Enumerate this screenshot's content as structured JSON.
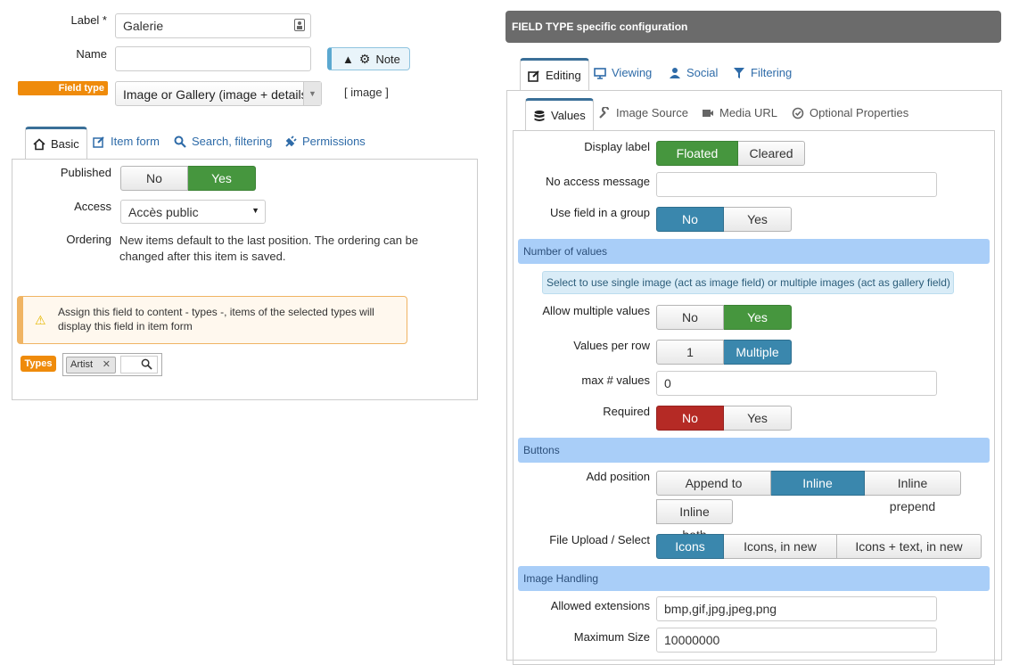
{
  "left": {
    "label_label": "Label *",
    "label_value": "Galerie",
    "name_label": "Name",
    "name_value": "",
    "note_label": "Note",
    "field_type_badge": "Field type",
    "field_type_value": "Image or Gallery (image + details)",
    "field_type_code": "[ image ]",
    "tabs": [
      {
        "label": "Basic",
        "icon": "home-icon"
      },
      {
        "label": "Item form",
        "icon": "edit-icon"
      },
      {
        "label": "Search, filtering",
        "icon": "search-icon"
      },
      {
        "label": "Permissions",
        "icon": "plug-icon"
      }
    ],
    "published_label": "Published",
    "published_no": "No",
    "published_yes": "Yes",
    "access_label": "Access",
    "access_value": "Accès public",
    "ordering_label": "Ordering",
    "ordering_text": "New items default to the last position. The ordering can be changed after this item is saved.",
    "warning_text": "Assign this field to content - types -, items of the selected types will display this field in item form",
    "types_badge": "Types",
    "types_tag": "Artist"
  },
  "right": {
    "header": "FIELD TYPE specific configuration",
    "tabs": [
      {
        "label": "Editing",
        "icon": "edit-icon"
      },
      {
        "label": "Viewing",
        "icon": "monitor-icon"
      },
      {
        "label": "Social",
        "icon": "user-icon"
      },
      {
        "label": "Filtering",
        "icon": "filter-icon"
      }
    ],
    "subtabs": [
      {
        "label": "Values",
        "icon": "database-icon"
      },
      {
        "label": "Image Source",
        "icon": "wrench-icon"
      },
      {
        "label": "Media URL",
        "icon": "video-icon"
      },
      {
        "label": "Optional Properties",
        "icon": "check-circle-icon"
      }
    ],
    "display_label": "Display label",
    "display_opts": [
      "Floated left",
      "Cleared"
    ],
    "no_access_label": "No access message",
    "no_access_value": "",
    "use_group_label": "Use field in a group",
    "use_group_opts": [
      "No",
      "Yes"
    ],
    "section_values": "Number of values",
    "values_info": "Select to use single image (act as image field) or multiple images (act as gallery field)",
    "allow_multiple_label": "Allow multiple values",
    "allow_multiple_opts": [
      "No",
      "Yes"
    ],
    "values_per_row_label": "Values per row",
    "values_per_row_opts": [
      "1",
      "Multiple"
    ],
    "max_values_label": "max # values",
    "max_values_value": "0",
    "required_label": "Required",
    "required_opts": [
      "No",
      "Yes"
    ],
    "section_buttons": "Buttons",
    "add_position_label": "Add position",
    "add_position_opts": [
      "Append to bottom",
      "Inline append",
      "Inline prepend"
    ],
    "add_position_opt4": "Inline both",
    "file_upload_label": "File Upload / Select",
    "file_upload_opts": [
      "Icons",
      "Icons, in new row",
      "Icons + text, in new row"
    ],
    "section_image": "Image Handling",
    "allowed_ext_label": "Allowed extensions",
    "allowed_ext_value": "bmp,gif,jpg,jpeg,png",
    "max_size_label": "Maximum Size",
    "max_size_value": "10000000"
  },
  "colors": {
    "green": "#46963e",
    "blue": "#3a87ad",
    "red": "#b52a25",
    "orange": "#ef8b0b",
    "section": "#a9cef8"
  }
}
